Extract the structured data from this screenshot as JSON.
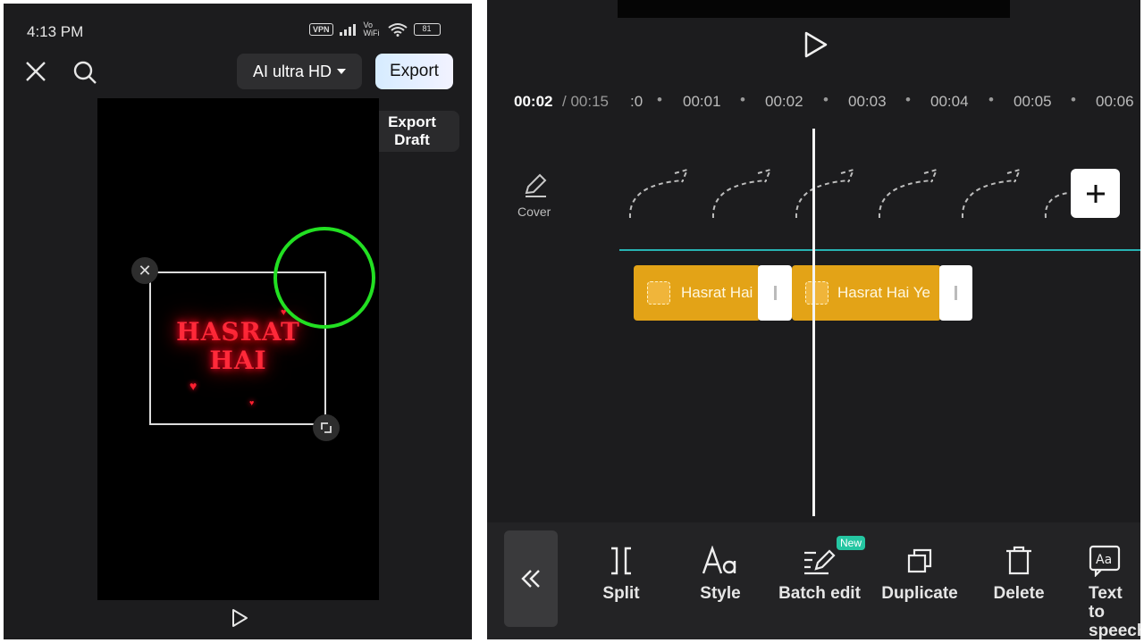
{
  "left_screen": {
    "status_bar": {
      "time": "4:13 PM",
      "vpn": "VPN",
      "volte": "Vo WiFi",
      "battery": "81"
    },
    "header": {
      "quality_label": "AI ultra HD",
      "export_label": "Export",
      "export_draft_label": "Export\nDraft"
    },
    "canvas": {
      "text_overlay": "HASRAT\nHAI"
    }
  },
  "right_screen": {
    "timeline": {
      "current_time": "00:02",
      "total_time": "/ 00:15",
      "ticks": [
        ":0",
        "00:01",
        "00:02",
        "00:03",
        "00:04",
        "00:05",
        "00:06"
      ]
    },
    "cover_label": "Cover",
    "clips": [
      {
        "label": "Hasrat Hai"
      },
      {
        "label": "Hasrat Hai Ye"
      }
    ],
    "toolbar": {
      "items": [
        {
          "label": "Split",
          "icon": "split-icon"
        },
        {
          "label": "Style",
          "icon": "style-icon"
        },
        {
          "label": "Batch edit",
          "icon": "batch-edit-icon",
          "badge": "New"
        },
        {
          "label": "Duplicate",
          "icon": "duplicate-icon"
        },
        {
          "label": "Delete",
          "icon": "delete-icon"
        },
        {
          "label": "Text to\nspeech",
          "icon": "text-to-speech-icon"
        }
      ]
    }
  },
  "colors": {
    "background": "#1c1c1e",
    "clip": "#e3a317",
    "track_line": "#27b3b3",
    "highlight_circle": "#22e022",
    "new_badge": "#25c6a2"
  }
}
